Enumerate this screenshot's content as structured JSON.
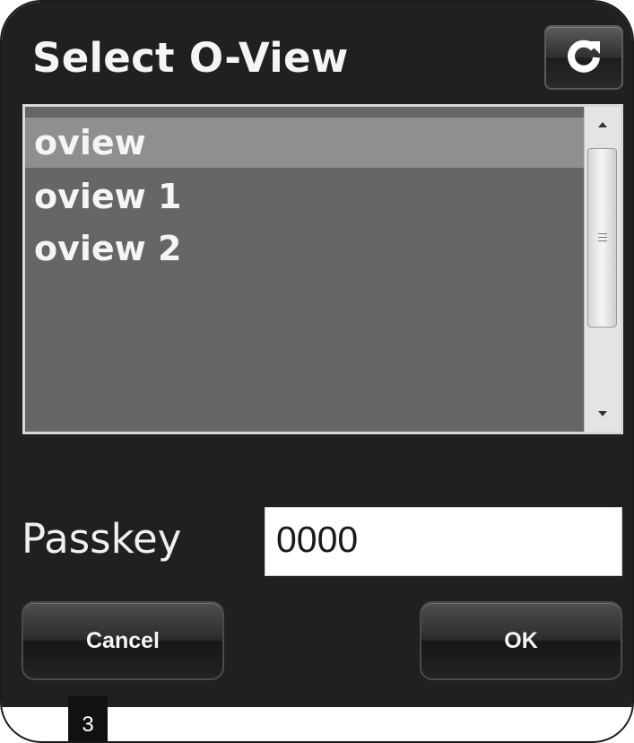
{
  "dialog": {
    "title": "Select O-View",
    "refresh_icon": "refresh-icon"
  },
  "list": {
    "items": [
      {
        "label": "oview",
        "selected": true
      },
      {
        "label": "oview 1",
        "selected": false
      },
      {
        "label": "oview 2",
        "selected": false
      }
    ],
    "scrollbar": {
      "up_icon": "scroll-up-arrow-icon",
      "down_icon": "scroll-down-arrow-icon"
    }
  },
  "passkey": {
    "label": "Passkey",
    "value": "0000"
  },
  "buttons": {
    "cancel_label": "Cancel",
    "ok_label": "OK"
  },
  "page": {
    "step_number": "3"
  },
  "colors": {
    "dialog_bg": "#221f1f",
    "list_bg": "#666666",
    "selected_row": "#8f8f8f",
    "text": "#f5f5f5"
  }
}
